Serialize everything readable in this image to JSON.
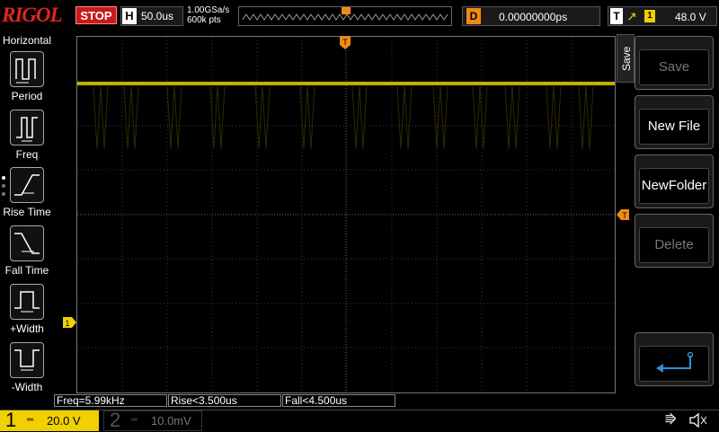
{
  "brand": "RIGOL",
  "run_state": "STOP",
  "timebase": {
    "label": "H",
    "value": "50.0us"
  },
  "sample": {
    "rate": "1.00GSa/s",
    "points": "600k pts"
  },
  "delay": {
    "label": "D",
    "value": "0.00000000ps"
  },
  "trigger": {
    "label": "T",
    "edge_icon": "rising-edge-icon",
    "source": "1",
    "level": "48.0 V",
    "marker": "T"
  },
  "left_menu": {
    "title": "Horizontal",
    "items": [
      {
        "label": "Period",
        "icon": "period-icon"
      },
      {
        "label": "Freq",
        "icon": "freq-icon"
      },
      {
        "label": "Rise Time",
        "icon": "rise-time-icon"
      },
      {
        "label": "Fall Time",
        "icon": "fall-time-icon"
      },
      {
        "label": "+Width",
        "icon": "positive-width-icon"
      },
      {
        "label": "-Width",
        "icon": "negative-width-icon"
      }
    ]
  },
  "right_menu": {
    "tab": "Save",
    "buttons": [
      {
        "label": "Save",
        "enabled": false
      },
      {
        "label": "New File",
        "enabled": true
      },
      {
        "label": "NewFolder",
        "enabled": true
      },
      {
        "label": "Delete",
        "enabled": false
      }
    ],
    "enter_icon": "enter-return-icon"
  },
  "measurements": {
    "freq": "Freq=5.99kHz",
    "rise": "Rise<3.500us",
    "fall": "Fall<4.500us"
  },
  "channels": {
    "ch1": {
      "num": "1",
      "coupling": "═",
      "scale": "20.0 V",
      "color": "#f0d000",
      "marker": "1"
    },
    "ch2": {
      "num": "2",
      "coupling": "═",
      "scale": "10.0mV",
      "color": "#1e90ff"
    }
  },
  "status_icons": {
    "usb": "⭆",
    "sound": "✕"
  },
  "colors": {
    "trace": "#c0b000",
    "trigger": "#f08a16",
    "stop": "#c81a1a"
  }
}
